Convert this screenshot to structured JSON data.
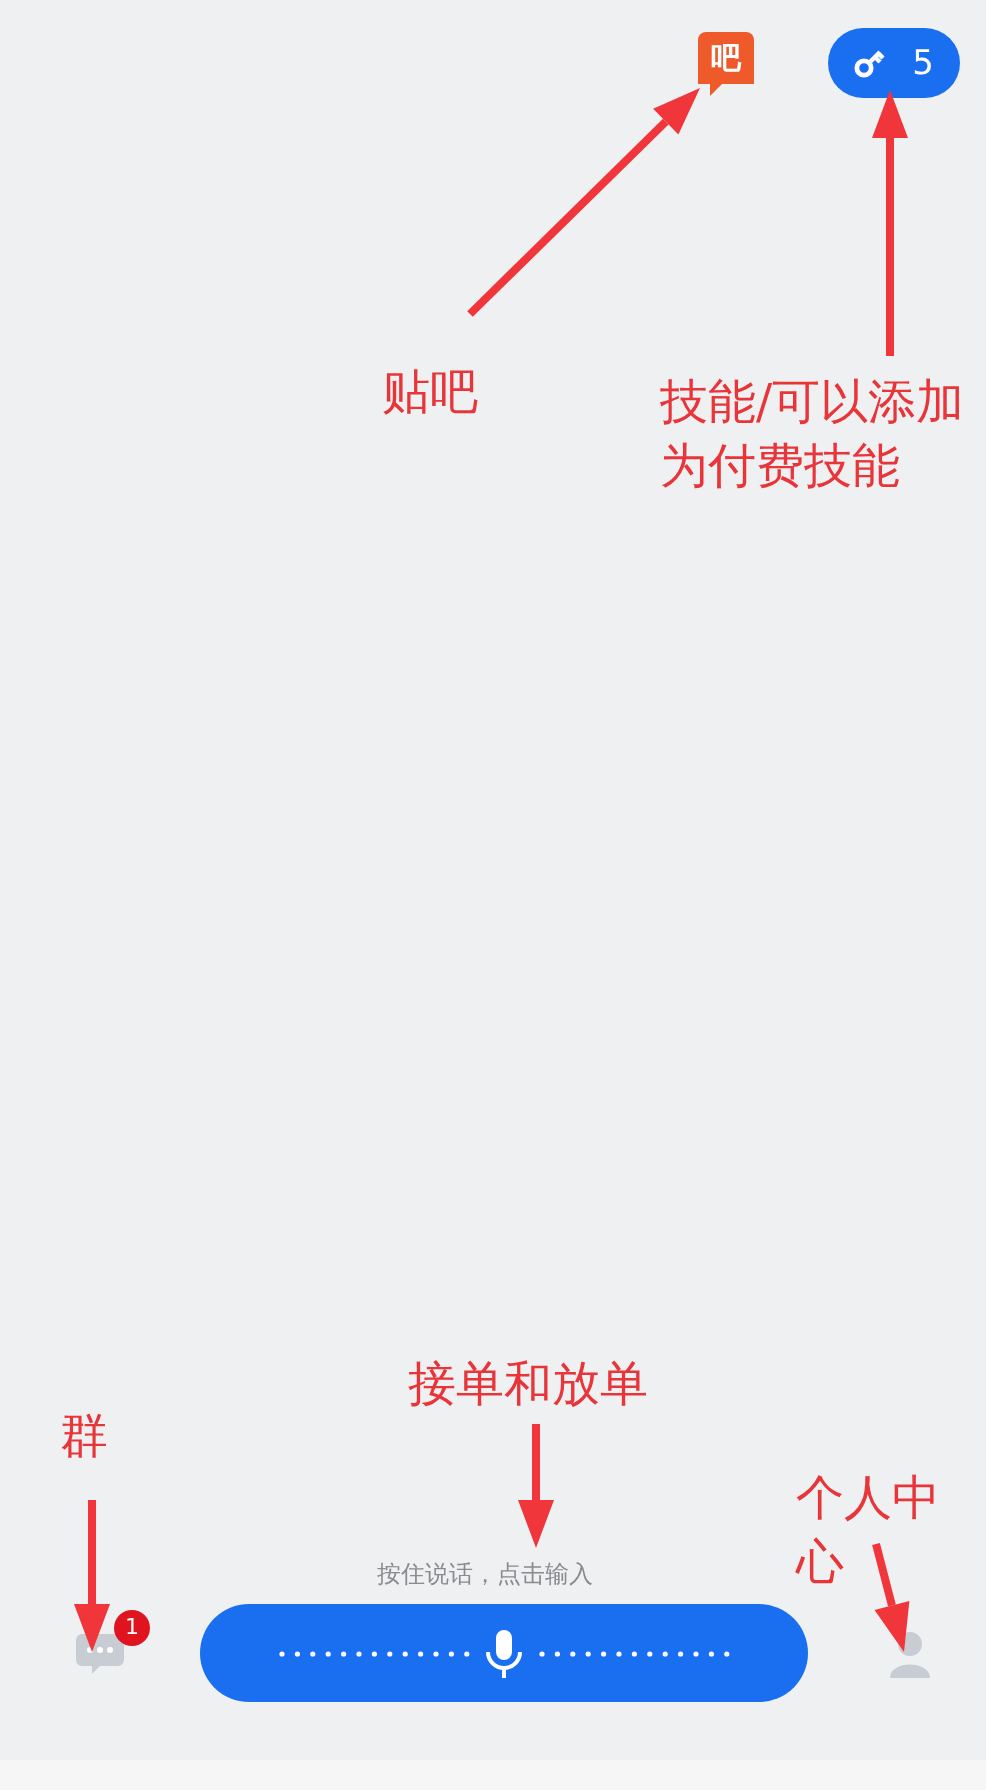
{
  "top_bar": {
    "tieba_badge": "吧",
    "skills_button": {
      "count": "5"
    }
  },
  "bottom_bar": {
    "hint": "按住说话，点击输入",
    "group_chat": {
      "unread": "1"
    }
  },
  "annotations": [
    {
      "text": "贴吧"
    },
    {
      "text": "技能/可以添加为付费技能"
    },
    {
      "text": "接单和放单"
    },
    {
      "text": "群"
    },
    {
      "text": "个人中心"
    }
  ]
}
